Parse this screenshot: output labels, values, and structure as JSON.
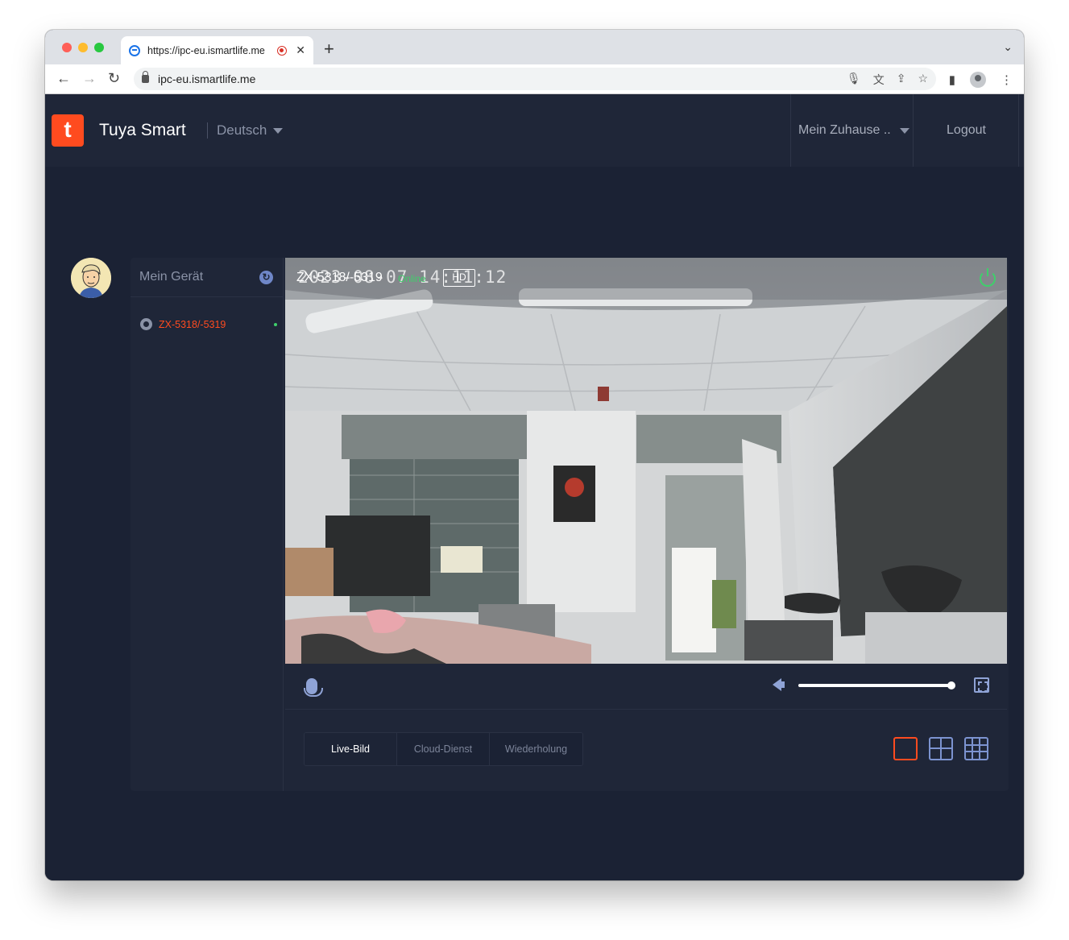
{
  "browser": {
    "tab_title": "https://ipc-eu.ismartlife.me",
    "tab_close": "✕",
    "new_tab": "+",
    "url": "ipc-eu.ismartlife.me"
  },
  "header": {
    "logo_glyph": "t",
    "brand": "Tuya Smart",
    "language": "Deutsch",
    "home": "Mein Zuhause ..",
    "logout": "Logout"
  },
  "sidebar": {
    "title": "Mein Gerät",
    "devices": [
      {
        "name": "ZX-5318/-5319",
        "status_color": "#3fcf6b"
      }
    ]
  },
  "video": {
    "timestamp": "2023-08-07 14:11:12",
    "camera_name": "ZX-5318/-5319",
    "status": "Online",
    "quality": "HD",
    "volume_fraction": 1.0
  },
  "tabs": [
    "Live-Bild",
    "Cloud-Dienst",
    "Wiederholung"
  ],
  "colors": {
    "accent": "#ff4b1f",
    "online": "#3fcf6b",
    "background": "#1b2234",
    "icon": "#7c93d0"
  }
}
